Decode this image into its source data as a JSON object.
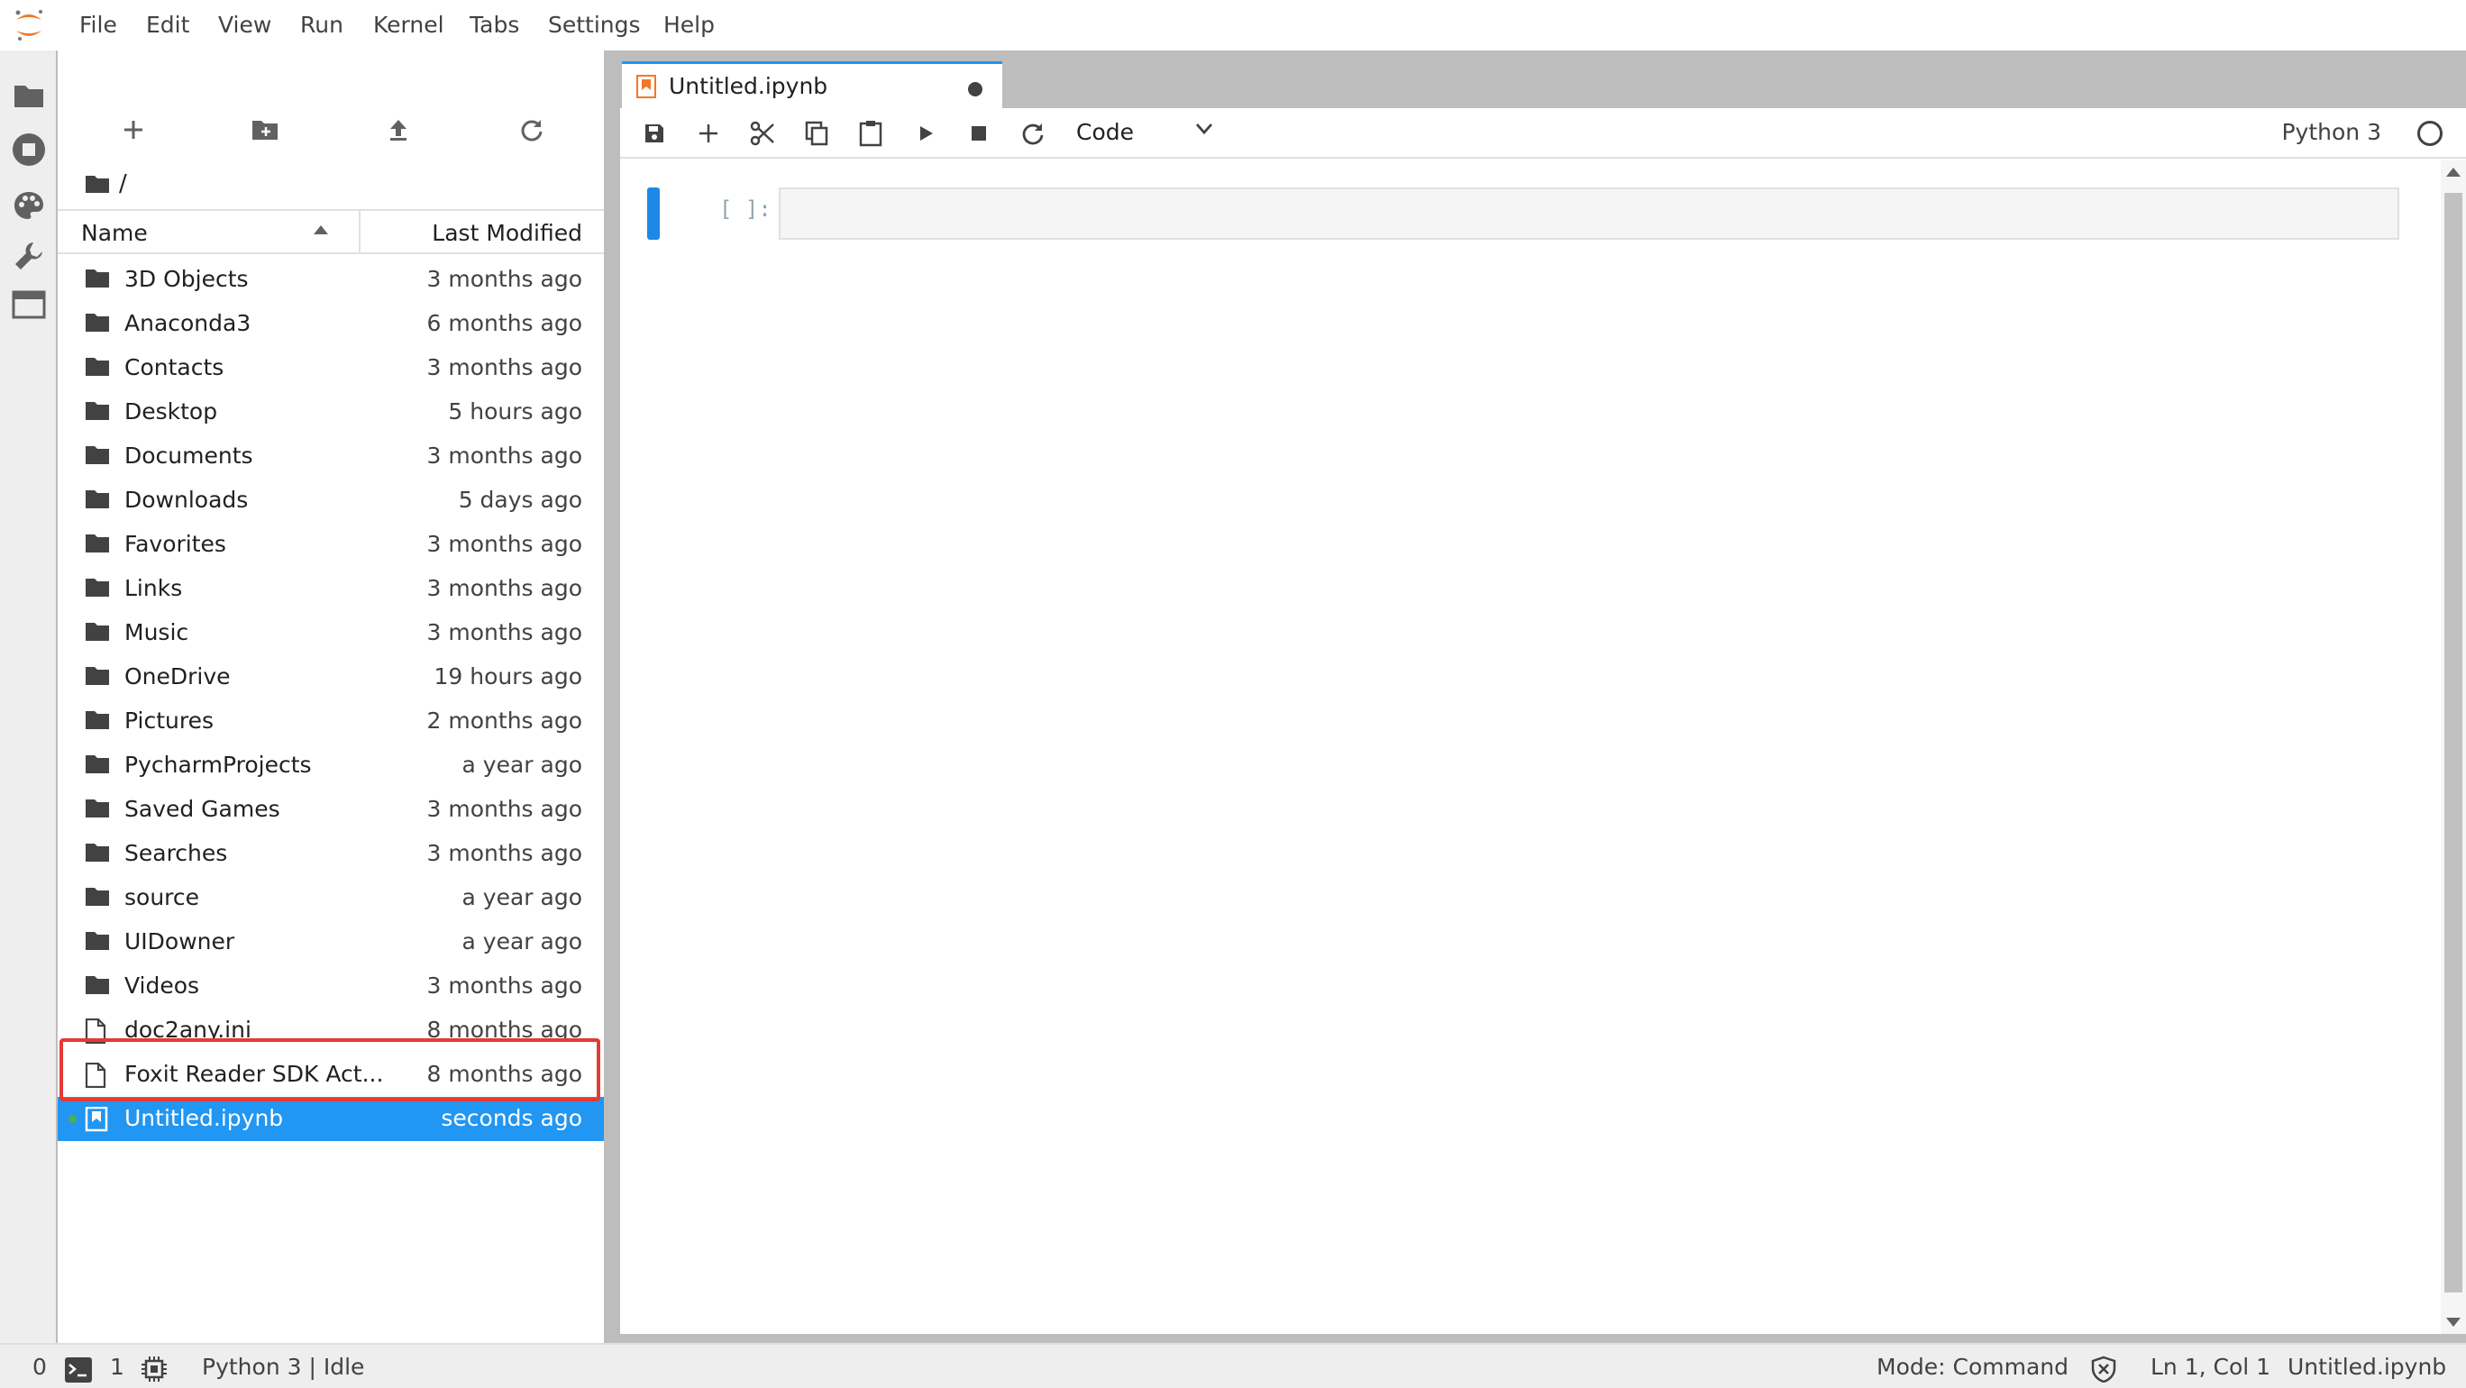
{
  "app": {
    "logo": "jupyter-logo"
  },
  "menu": [
    "File",
    "Edit",
    "View",
    "Run",
    "Kernel",
    "Tabs",
    "Settings",
    "Help"
  ],
  "activity_icons": [
    "folder-icon",
    "running-icon",
    "palette-icon",
    "wrench-icon",
    "tabs-icon"
  ],
  "file_browser": {
    "toolbar_icons": [
      "new-launcher-icon",
      "new-folder-icon",
      "upload-icon",
      "refresh-icon"
    ],
    "breadcrumb": "/",
    "columns": {
      "name": "Name",
      "modified": "Last Modified"
    },
    "items": [
      {
        "name": "3D Objects",
        "modified": "3 months ago",
        "type": "folder"
      },
      {
        "name": "Anaconda3",
        "modified": "6 months ago",
        "type": "folder"
      },
      {
        "name": "Contacts",
        "modified": "3 months ago",
        "type": "folder"
      },
      {
        "name": "Desktop",
        "modified": "5 hours ago",
        "type": "folder"
      },
      {
        "name": "Documents",
        "modified": "3 months ago",
        "type": "folder"
      },
      {
        "name": "Downloads",
        "modified": "5 days ago",
        "type": "folder"
      },
      {
        "name": "Favorites",
        "modified": "3 months ago",
        "type": "folder"
      },
      {
        "name": "Links",
        "modified": "3 months ago",
        "type": "folder"
      },
      {
        "name": "Music",
        "modified": "3 months ago",
        "type": "folder"
      },
      {
        "name": "OneDrive",
        "modified": "19 hours ago",
        "type": "folder"
      },
      {
        "name": "Pictures",
        "modified": "2 months ago",
        "type": "folder"
      },
      {
        "name": "PycharmProjects",
        "modified": "a year ago",
        "type": "folder"
      },
      {
        "name": "Saved Games",
        "modified": "3 months ago",
        "type": "folder"
      },
      {
        "name": "Searches",
        "modified": "3 months ago",
        "type": "folder"
      },
      {
        "name": "source",
        "modified": "a year ago",
        "type": "folder"
      },
      {
        "name": "UIDowner",
        "modified": "a year ago",
        "type": "folder"
      },
      {
        "name": "Videos",
        "modified": "3 months ago",
        "type": "folder"
      },
      {
        "name": "doc2any.ini",
        "modified": "8 months ago",
        "type": "file"
      },
      {
        "name": "Foxit Reader SDK Act...",
        "modified": "8 months ago",
        "type": "file"
      },
      {
        "name": "Untitled.ipynb",
        "modified": "seconds ago",
        "type": "notebook",
        "selected": true,
        "running": true
      }
    ]
  },
  "tab": {
    "title": "Untitled.ipynb",
    "dirty": true
  },
  "notebook_toolbar": {
    "icons": [
      "save-icon",
      "add-cell-icon",
      "cut-icon",
      "copy-icon",
      "paste-icon",
      "run-icon",
      "stop-icon",
      "restart-icon"
    ],
    "cell_type": "Code",
    "kernel": "Python 3"
  },
  "cell": {
    "prompt": "[ ]:",
    "source": ""
  },
  "status": {
    "terminals": "0",
    "kernels": "1",
    "kernel_status": "Python 3 | Idle",
    "mode": "Mode: Command",
    "position": "Ln 1, Col 1",
    "file": "Untitled.ipynb"
  },
  "colors": {
    "accent": "#2196f3",
    "selection": "#2196f3",
    "highlight_border": "#e53935",
    "logo": "#f37726"
  }
}
